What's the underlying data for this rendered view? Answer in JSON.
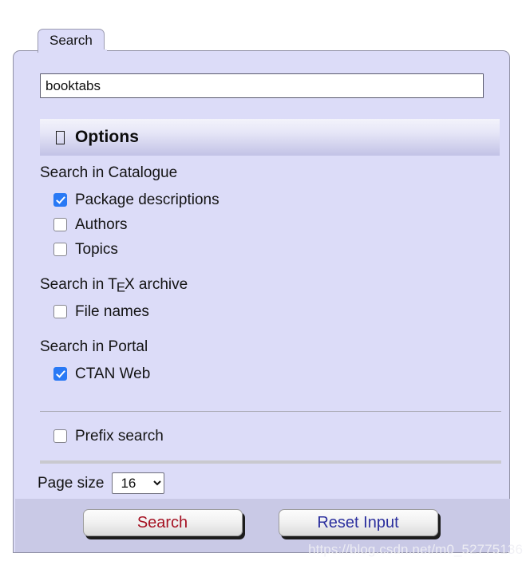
{
  "tab": {
    "label": "Search"
  },
  "search": {
    "query_value": "booktabs",
    "placeholder": ""
  },
  "options_header": {
    "icon": "missing-glyph-box-icon",
    "label": "Options"
  },
  "groups": [
    {
      "title": "Search in Catalogue",
      "items": [
        {
          "label": "Package descriptions",
          "checked": true
        },
        {
          "label": "Authors",
          "checked": false
        },
        {
          "label": "Topics",
          "checked": false
        }
      ]
    },
    {
      "title_prefix": "Search in ",
      "title_tex": "TeX",
      "title_suffix": " archive",
      "items": [
        {
          "label": "File names",
          "checked": false
        }
      ]
    },
    {
      "title": "Search in Portal",
      "items": [
        {
          "label": "CTAN Web",
          "checked": true
        }
      ]
    }
  ],
  "prefix_search": {
    "label": "Prefix search",
    "checked": false
  },
  "page_size": {
    "label": "Page size",
    "selected": "16",
    "options": [
      "16"
    ]
  },
  "footer": {
    "search_label": "Search",
    "reset_label": "Reset Input"
  },
  "watermark": {
    "text": "https://blog.csdn.net/m0_52775136"
  },
  "colors": {
    "panel_bg": "#dcdcf8",
    "footer_bg": "#c9c9e6",
    "checkbox_on": "#2979f5",
    "search_text": "#a51122",
    "reset_text": "#2b2f9e",
    "border": "#8f8fa4"
  }
}
